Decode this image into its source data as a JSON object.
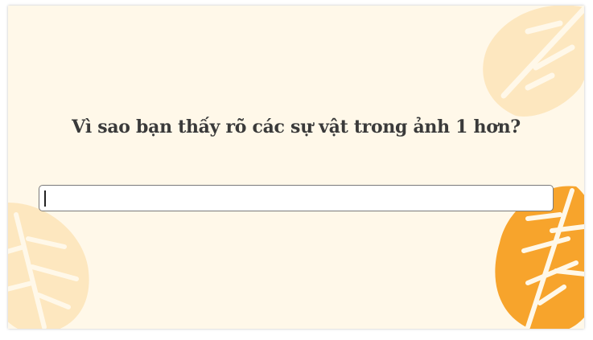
{
  "question": {
    "text": "Vì sao bạn thấy rõ các sự vật trong ảnh 1 hơn?"
  },
  "answer": {
    "value": "",
    "placeholder": ""
  },
  "decorations": {
    "leaf_icon": "monstera-leaf-icon",
    "leaf_light_color": "#fde7bf",
    "leaf_orange_color": "#f7a42c",
    "background_color": "#fff8e9"
  }
}
